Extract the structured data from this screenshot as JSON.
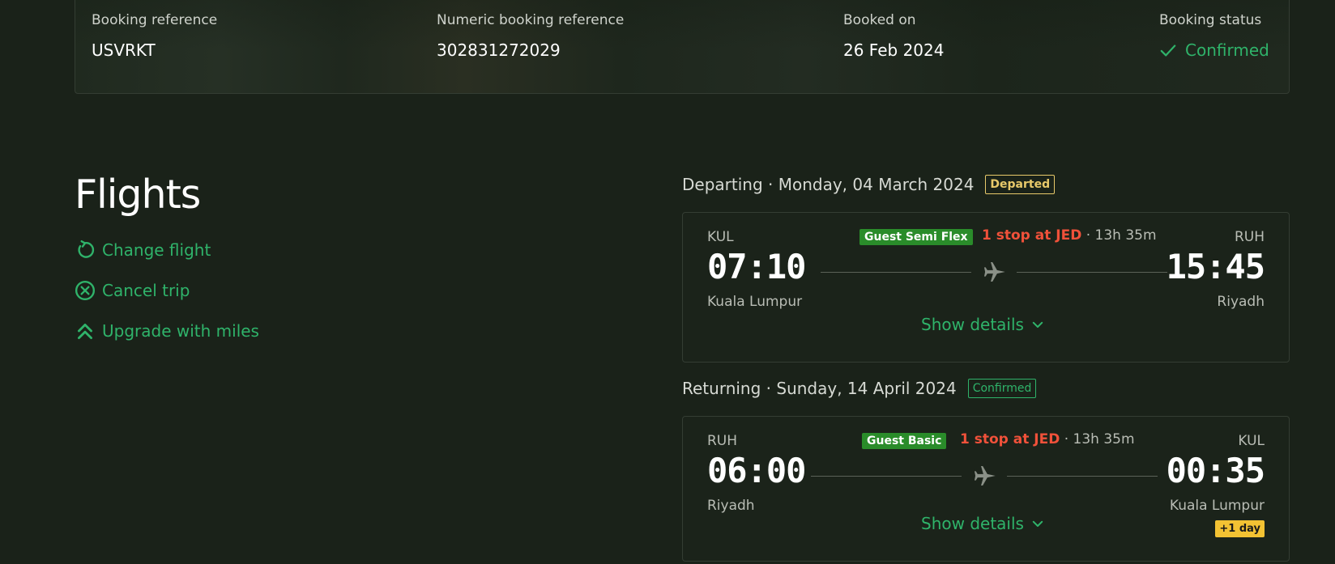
{
  "summary": {
    "booking_reference_label": "Booking reference",
    "booking_reference": "USVRKT",
    "numeric_reference_label": "Numeric booking reference",
    "numeric_reference": "302831272029",
    "booked_on_label": "Booked on",
    "booked_on": "26 Feb 2024",
    "status_label": "Booking status",
    "status": "Confirmed"
  },
  "left": {
    "title": "Flights",
    "actions": [
      {
        "label": "Change flight",
        "icon": "refresh-icon"
      },
      {
        "label": "Cancel trip",
        "icon": "circle-x-icon"
      },
      {
        "label": "Upgrade with miles",
        "icon": "double-chevron-up-icon"
      }
    ]
  },
  "departing": {
    "heading": "Departing · Monday, 04 March 2024",
    "badge": "Departed",
    "from_code": "KUL",
    "from_time": "07:10",
    "from_city": "Kuala Lumpur",
    "to_code": "RUH",
    "to_time": "15:45",
    "to_city": "Riyadh",
    "fare": "Guest Semi Flex",
    "stops": "1 stop at JED",
    "duration": "13h 35m",
    "details": "Show details"
  },
  "returning": {
    "heading": "Returning · Sunday, 14 April 2024",
    "badge": "Confirmed",
    "from_code": "RUH",
    "from_time": "06:00",
    "from_city": "Riyadh",
    "to_code": "KUL",
    "to_time": "00:35",
    "to_city": "Kuala Lumpur",
    "fare": "Guest Basic",
    "stops": "1 stop at JED",
    "duration": "13h 35m",
    "details": "Show details",
    "next_day": "+1 day"
  },
  "colors": {
    "background": "#1a2219",
    "accent_green": "#2fb36a",
    "stop_red": "#f0513a",
    "badge_yellow": "#f3c233"
  }
}
